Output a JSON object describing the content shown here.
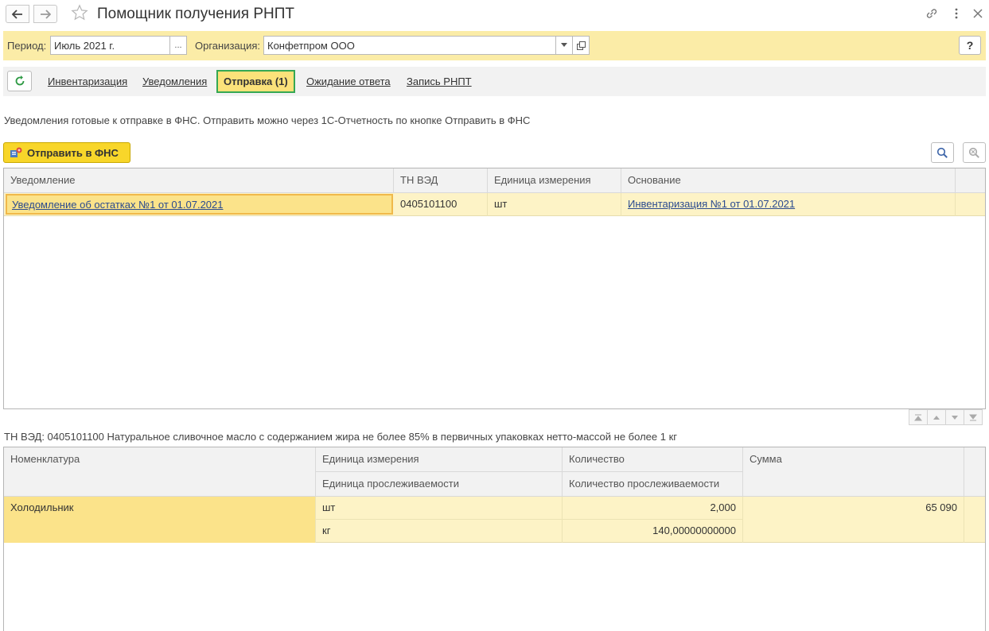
{
  "window": {
    "title": "Помощник получения РНПТ",
    "back_icon": "arrow-left-icon",
    "forward_icon": "arrow-right-icon",
    "favorite_icon": "star-icon",
    "link_icon": "link-icon",
    "menu_icon": "more-vertical-icon",
    "close_icon": "close-icon"
  },
  "filter": {
    "period_label": "Период:",
    "period_value": "Июль 2021 г.",
    "period_button": "...",
    "org_label": "Организация:",
    "org_value": "Конфетпром ООО",
    "help_label": "?"
  },
  "tabs": [
    {
      "label": "Инвентаризация"
    },
    {
      "label": "Уведомления"
    },
    {
      "label": "Отправка (1)",
      "active": true
    },
    {
      "label": "Ожидание ответа"
    },
    {
      "label": "Запись РНПТ"
    }
  ],
  "info_text": "Уведомления готовые к отправке в ФНС. Отправить можно через 1С-Отчетность по кнопке Отправить в ФНС",
  "toolbar": {
    "send_label": "Отправить в ФНС"
  },
  "notifications_table": {
    "columns": [
      "Уведомление",
      "ТН ВЭД",
      "Единица измерения",
      "Основание"
    ],
    "rows": [
      {
        "notification": "Уведомление об остатках №1 от 01.07.2021",
        "tnved": "0405101100",
        "unit": "шт",
        "basis": "Инвентаризация №1 от 01.07.2021"
      }
    ]
  },
  "tnved_line": "ТН ВЭД: 0405101100 Натуральное сливочное масло с содержанием жира не более 85% в первичных упаковках нетто-массой не более 1 кг",
  "items_table": {
    "columns": {
      "nomenclature": "Номенклатура",
      "unit": "Единица измерения",
      "trace_unit": "Единица прослеживаемости",
      "qty": "Количество",
      "trace_qty": "Количество прослеживаемости",
      "sum": "Сумма"
    },
    "rows": [
      {
        "nomenclature": "Холодильник",
        "unit": "шт",
        "trace_unit": "кг",
        "qty": "2,000",
        "trace_qty": "140,00000000000",
        "sum": "65 090"
      }
    ]
  },
  "colors": {
    "accent_yellow": "#f8d62a",
    "filter_bg": "#fbeca7",
    "active_tab_border": "#35a853",
    "selected_row": "#fdf3c6",
    "selected_cell": "#fbe38a"
  }
}
